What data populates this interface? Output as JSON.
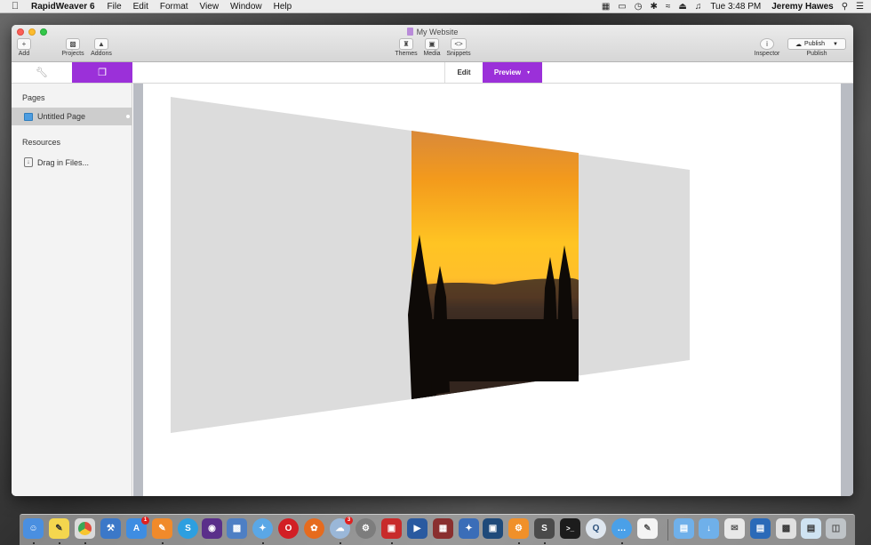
{
  "menubar": {
    "app_name": "RapidWeaver 6",
    "items": [
      "File",
      "Edit",
      "Format",
      "View",
      "Window",
      "Help"
    ],
    "clock": "Tue 3:48 PM",
    "user": "Jeremy Hawes"
  },
  "window": {
    "title": "My Website"
  },
  "toolbar": {
    "add_label": "Add",
    "projects_label": "Projects",
    "addons_label": "Addons",
    "themes_label": "Themes",
    "media_label": "Media",
    "snippets_label": "Snippets",
    "inspector_label": "Inspector",
    "publish_button": "Publish",
    "publish_label": "Publish"
  },
  "modes": {
    "edit": "Edit",
    "preview": "Preview"
  },
  "sidebar": {
    "pages_header": "Pages",
    "pages": [
      {
        "label": "Untitled Page"
      }
    ],
    "resources_header": "Resources",
    "drag_files": "Drag in Files..."
  },
  "dock": {
    "icons": [
      "finder-icon",
      "stickies-icon",
      "chrome-icon",
      "xcode-icon",
      "app-store-icon",
      "pages-icon",
      "skype-icon",
      "photo-booth-icon",
      "screenshot-icon",
      "safari-icon",
      "opera-icon",
      "firefox-icon",
      "cloud-app-icon",
      "system-preferences-icon",
      "remote-desktop-icon",
      "imovie-icon",
      "photo-slideshow-icon",
      "twitter-icon",
      "spaces-icon",
      "settings-icon",
      "sublime-text-icon",
      "terminal-icon",
      "quicktime-icon",
      "messages-icon",
      "textedit-icon",
      "applications-folder-icon",
      "downloads-folder-icon",
      "mail-stack-icon",
      "documents-stack-icon",
      "desktop-stack-icon",
      "screenshots-stack-icon",
      "trash-icon"
    ],
    "app_store_badge": "1",
    "cloud_app_badge": "3"
  },
  "colors": {
    "accent": "#9b30d9"
  }
}
